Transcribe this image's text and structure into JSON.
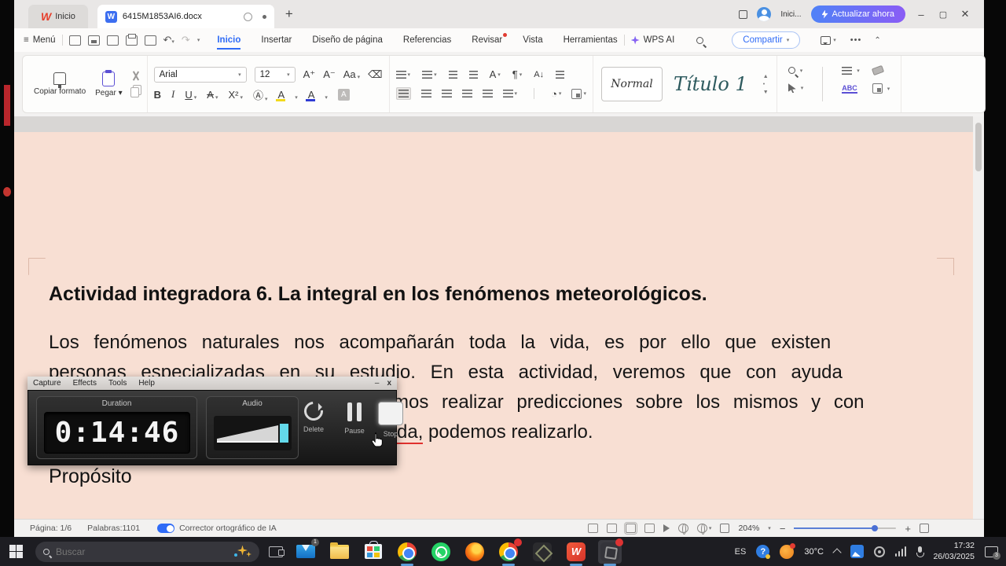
{
  "titlebar": {
    "home_tab": "Inicio",
    "doc_tab": "6415M1853AI6.docx",
    "account": "Inici...",
    "update_button": "Actualizar ahora"
  },
  "menubar": {
    "menu_label": "Menú",
    "tabs": [
      {
        "label": "Inicio"
      },
      {
        "label": "Insertar"
      },
      {
        "label": "Diseño de página"
      },
      {
        "label": "Referencias"
      },
      {
        "label": "Revisar"
      },
      {
        "label": "Vista"
      },
      {
        "label": "Herramientas"
      }
    ],
    "wps_ai": "WPS AI",
    "share_button": "Compartir"
  },
  "ribbon": {
    "copy_format": "Copiar formato",
    "paste": "Pegar",
    "font_name": "Arial",
    "font_size": "12",
    "bold": "B",
    "italic": "I",
    "underline": "U",
    "style_normal": "Normal",
    "style_heading1": "Título 1"
  },
  "document": {
    "heading": "Actividad integradora 6. La integral en los fenómenos meteorológicos.",
    "line1": "Los fenómenos naturales nos acompañarán toda la vida, es por ello que existen",
    "line2": "personas especializadas en su estudio. En esta actividad, veremos que con ayuda",
    "line3_fragment": "mos realizar predicciones sobre los mismos y con",
    "line4_misspelled": "da,",
    "line4_rest": " podemos realizarlo.",
    "subheading": "Propósito"
  },
  "recorder": {
    "menu": [
      "Capture",
      "Effects",
      "Tools",
      "Help"
    ],
    "duration_label": "Duration",
    "duration_value": "0:14:46",
    "audio_label": "Audio",
    "delete_label": "Delete",
    "pause_label": "Pause",
    "stop_label": "Stop",
    "minimize": "–",
    "close": "x"
  },
  "statusbar": {
    "page": "Página: 1/6",
    "words": "Palabras:1101",
    "spellcheck_label": "Corrector ortográfico de IA",
    "zoom_level": "204%"
  },
  "taskbar": {
    "search_placeholder": "Buscar",
    "language": "ES",
    "temperature": "30°C",
    "time": "17:32",
    "date": "26/03/2025",
    "notification_count": "3",
    "mail_badge": "1"
  },
  "colors": {
    "accent_blue": "#2f6bf6",
    "page_background": "#f8dfd3",
    "wps_red": "#e6402d",
    "update_gradient": [
      "#4f82f7",
      "#8a5cf5"
    ],
    "taskbar_background": "#1d1d22",
    "spell_underline": "#e0312e",
    "audio_meter_cap": "#63d9ea"
  }
}
